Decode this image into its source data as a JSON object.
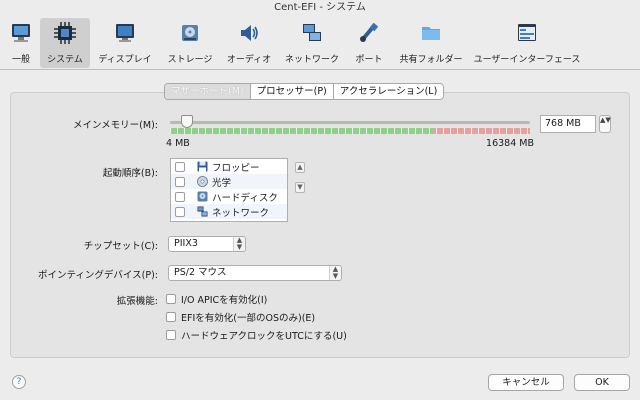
{
  "window": {
    "title": "Cent-EFI - システム"
  },
  "toolbar": {
    "items": [
      {
        "label": "一般",
        "icon": "monitor-general-icon"
      },
      {
        "label": "システム",
        "icon": "chip-icon"
      },
      {
        "label": "ディスプレイ",
        "icon": "display-icon"
      },
      {
        "label": "ストレージ",
        "icon": "storage-icon"
      },
      {
        "label": "オーディオ",
        "icon": "speaker-icon"
      },
      {
        "label": "ネットワーク",
        "icon": "network-icon"
      },
      {
        "label": "ポート",
        "icon": "port-icon"
      },
      {
        "label": "共有フォルダー",
        "icon": "folder-icon"
      },
      {
        "label": "ユーザーインターフェース",
        "icon": "ui-window-icon"
      }
    ],
    "selected": "システム"
  },
  "tabs": [
    {
      "label": "マザーボード(M)",
      "selected": true
    },
    {
      "label": "プロセッサー(P)",
      "selected": false
    },
    {
      "label": "アクセラレーション(L)",
      "selected": false
    }
  ],
  "memory": {
    "label": "メインメモリー(M):",
    "value": "768 MB",
    "min_label": "4 MB",
    "max_label": "16384 MB",
    "slider_value_mb": 768,
    "slider_min_mb": 4,
    "slider_max_mb": 16384,
    "safe_fraction": 0.73,
    "colors": {
      "safe": "#8fd18a",
      "unsafe": "#e5a0a0"
    }
  },
  "boot": {
    "label": "起動順序(B):",
    "items": [
      {
        "label": "フロッピー",
        "icon": "floppy-icon",
        "checked": false
      },
      {
        "label": "光学",
        "icon": "optical-disc-icon",
        "checked": false
      },
      {
        "label": "ハードディスク",
        "icon": "hard-disk-icon",
        "checked": false
      },
      {
        "label": "ネットワーク",
        "icon": "network-icon",
        "checked": false
      }
    ],
    "up_glyph": "▲",
    "down_glyph": "▼"
  },
  "chipset": {
    "label": "チップセット(C):",
    "value": "PIIX3"
  },
  "pointing": {
    "label": "ポインティングデバイス(P):",
    "value": "PS/2 マウス"
  },
  "extended": {
    "label": "拡張機能:",
    "options": [
      {
        "label": "I/O APICを有効化(I)",
        "checked": false
      },
      {
        "label": "EFIを有効化(一部のOSのみ)(E)",
        "checked": false
      },
      {
        "label": "ハードウェアクロックをUTCにする(U)",
        "checked": false
      }
    ]
  },
  "footer": {
    "help": "?",
    "cancel": "キャンセル",
    "ok": "OK"
  },
  "glyphs": {
    "caret": "▲▼"
  }
}
